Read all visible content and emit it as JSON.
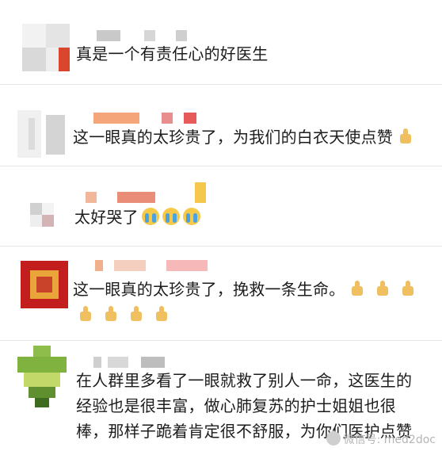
{
  "comments": [
    {
      "text": "真是一个有责任心的好医生"
    },
    {
      "text": "这一眼真的太珍贵了，为我们的白衣天使点赞"
    },
    {
      "text": "太好哭了"
    },
    {
      "text": "这一眼真的太珍贵了，挽救一条生命。"
    },
    {
      "text": "在人群里多看了一眼就救了别人一命，这医生的\n经验也是很丰富，做心肺复苏的护士姐姐也很\n棒，那样子跪着肯定很不舒服，为你们医护点赞"
    }
  ],
  "emojis": {
    "thumbs_up": "thumbs-up-icon",
    "crying": "crying-face-icon"
  },
  "watermark": {
    "text": "微信号: med2doc"
  }
}
